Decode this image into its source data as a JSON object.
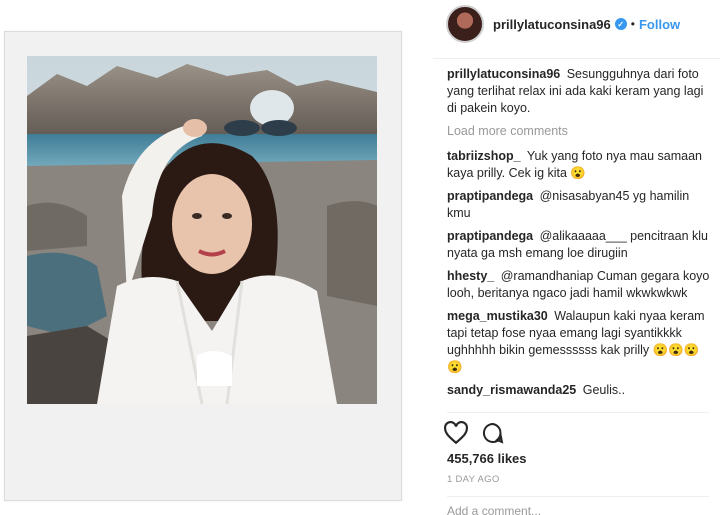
{
  "post": {
    "username": "prillylatuconsina96",
    "follow_label": "Follow",
    "separator": "•",
    "verified_glyph": "✓",
    "caption": "Sesungguhnya dari foto yang terlihat relax ini ada kaki keram yang lagi di pakein koyo.",
    "load_more": "Load more comments",
    "likes": "455,766 likes",
    "time_ago": "1 DAY AGO",
    "add_comment_placeholder": "Add a comment..."
  },
  "comments": [
    {
      "user": "tabriizshop_",
      "text": "Yuk yang foto nya mau samaan kaya prilly. Cek ig kita 😮"
    },
    {
      "user": "praptipandega",
      "text": "@nisasabyan45 yg hamilin kmu"
    },
    {
      "user": "praptipandega",
      "text": "@alikaaaaa___ pencitraan klu nyata ga msh emang loe dirugiin"
    },
    {
      "user": "hhesty_",
      "text": "@ramandhaniap Cuman gegara koyo looh, beritanya ngaco jadi hamil wkwkwkwk"
    },
    {
      "user": "mega_mustika30",
      "text": "Walaupun kaki nyaa keram tapi tetap fose nyaa emang lagi syantikkkk ughhhhh bikin gemessssss kak prilly 😮😮😮😮"
    },
    {
      "user": "sandy_rismawanda25",
      "text": "Geulis.."
    }
  ],
  "icons": {
    "like": "heart-icon",
    "comment": "speech-bubble-icon"
  },
  "colors": {
    "link_blue": "#3897f0",
    "text_dark": "#262626",
    "muted": "#999999"
  }
}
